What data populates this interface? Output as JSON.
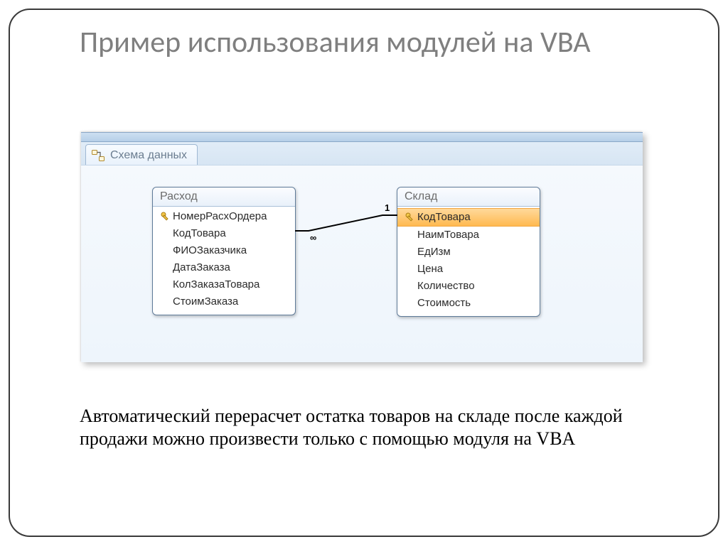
{
  "slide": {
    "title": "Пример использования модулей на VBA",
    "bodyText": "Автоматический перерасчет остатка товаров на складе после каждой продажи можно произвести только с помощью модуля на VBA"
  },
  "window": {
    "tabLabel": "Схема данных",
    "tabIconName": "relationships-icon"
  },
  "tables": [
    {
      "id": "left",
      "title": "Расход",
      "fields": [
        {
          "name": "НомерРасхОрдера",
          "isKey": true,
          "selected": false
        },
        {
          "name": "КодТовара",
          "isKey": false,
          "selected": false
        },
        {
          "name": "ФИОЗаказчика",
          "isKey": false,
          "selected": false
        },
        {
          "name": "ДатаЗаказа",
          "isKey": false,
          "selected": false
        },
        {
          "name": "КолЗаказаТовара",
          "isKey": false,
          "selected": false
        },
        {
          "name": "СтоимЗаказа",
          "isKey": false,
          "selected": false
        }
      ]
    },
    {
      "id": "right",
      "title": "Склад",
      "fields": [
        {
          "name": "КодТовара",
          "isKey": true,
          "selected": true
        },
        {
          "name": "НаимТовара",
          "isKey": false,
          "selected": false
        },
        {
          "name": "ЕдИзм",
          "isKey": false,
          "selected": false
        },
        {
          "name": "Цена",
          "isKey": false,
          "selected": false
        },
        {
          "name": "Количество",
          "isKey": false,
          "selected": false
        },
        {
          "name": "Стоимость",
          "isKey": false,
          "selected": false
        }
      ]
    }
  ],
  "relation": {
    "leftLabel": "∞",
    "rightLabel": "1"
  }
}
